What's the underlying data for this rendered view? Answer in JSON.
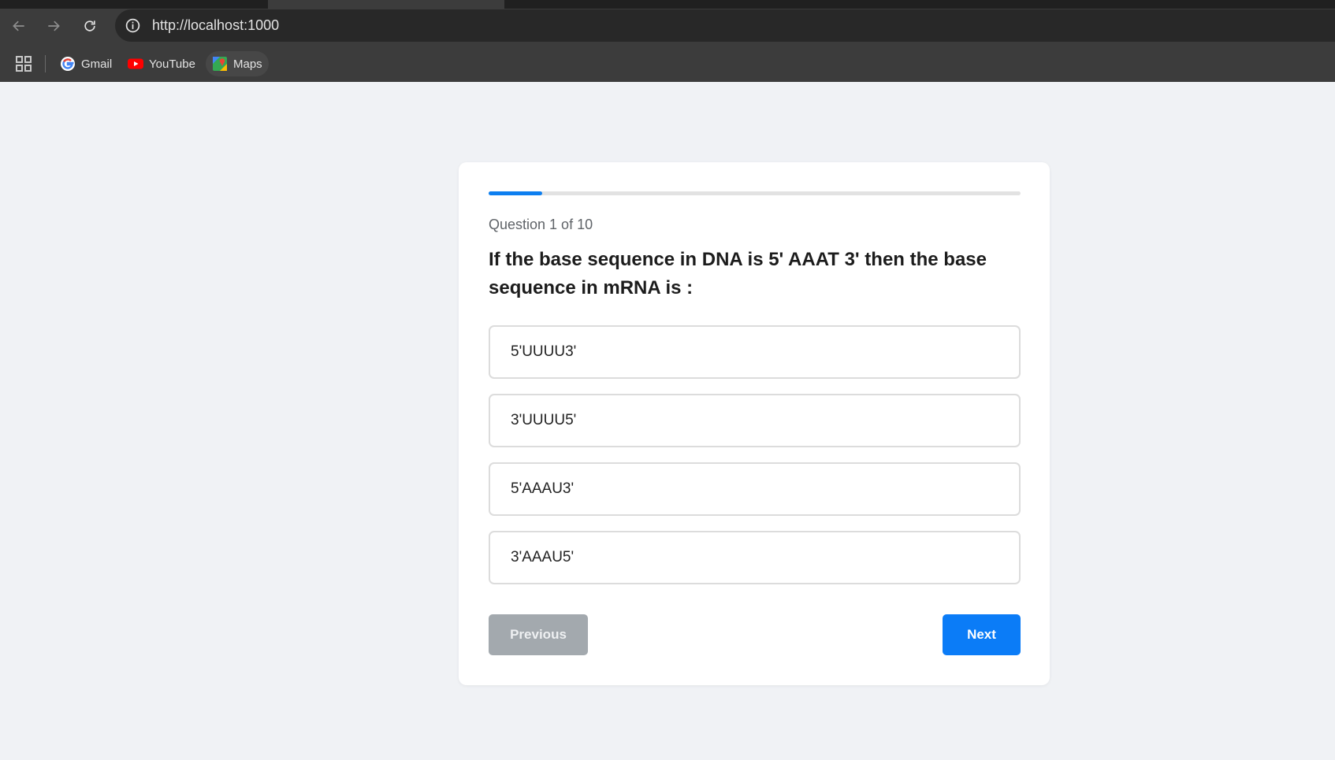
{
  "browser": {
    "url": "http://localhost:1000",
    "bookmarks": [
      {
        "label": "Gmail",
        "icon": "gmail-icon"
      },
      {
        "label": "YouTube",
        "icon": "youtube-icon"
      },
      {
        "label": "Maps",
        "icon": "maps-icon"
      }
    ]
  },
  "quiz": {
    "progress_fraction": 0.1,
    "counter": "Question 1 of 10",
    "question": "If the base sequence in DNA is 5' AAAT 3' then the base sequence in mRNA is :",
    "options": [
      "5'UUUU3'",
      "3'UUUU5'",
      "5'AAAU3'",
      "3'AAAU5'"
    ],
    "previous_label": "Previous",
    "next_label": "Next"
  },
  "colors": {
    "accent": "#0b7cf7",
    "disabled": "#a3a9ae",
    "page_bg": "#f0f2f5"
  }
}
